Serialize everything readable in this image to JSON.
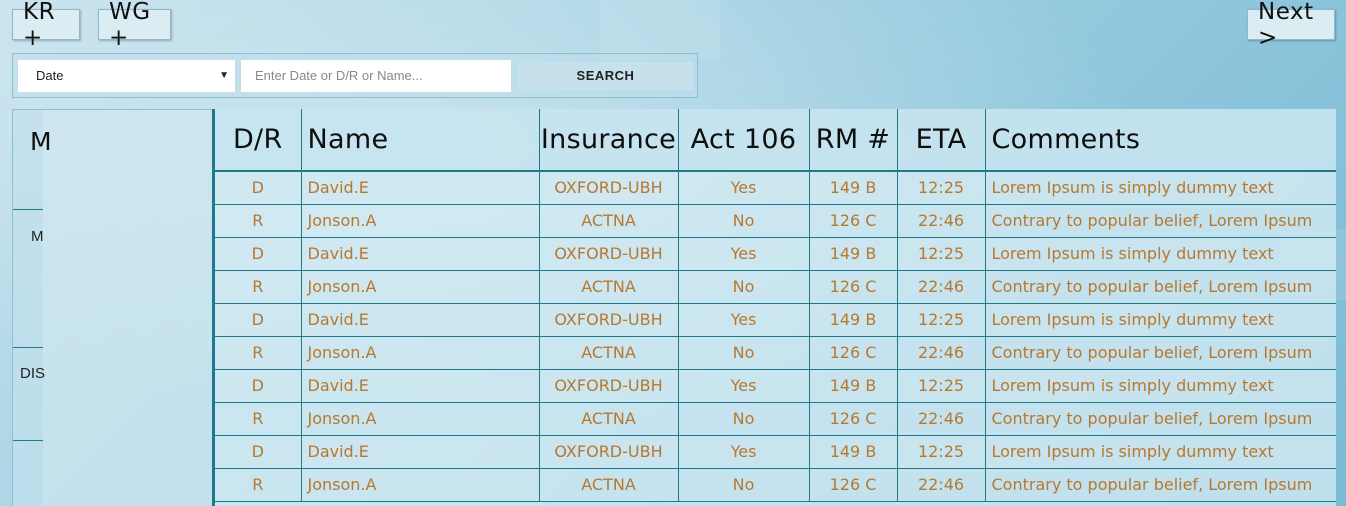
{
  "top_buttons": {
    "kr": "KR +",
    "wg": "WG +",
    "next": "Next >"
  },
  "search": {
    "select_value": "Date",
    "placeholder": "Enter Date or D/R or Name...",
    "button": "SEARCH"
  },
  "left_panel": {
    "heading": "M",
    "items": [
      "M",
      "DIS"
    ]
  },
  "table": {
    "columns": [
      "D/R",
      "Name",
      "Insurance",
      "Act 106",
      "RM #",
      "ETA",
      "Comments"
    ],
    "rows": [
      [
        "D",
        "David.E",
        "OXFORD-UBH",
        "Yes",
        "149 B",
        "12:25",
        "Lorem Ipsum is simply dummy text"
      ],
      [
        "R",
        "Jonson.A",
        "ACTNA",
        "No",
        "126 C",
        "22:46",
        "Contrary to popular belief, Lorem Ipsum"
      ],
      [
        "D",
        "David.E",
        "OXFORD-UBH",
        "Yes",
        "149 B",
        "12:25",
        "Lorem Ipsum is simply dummy text"
      ],
      [
        "R",
        "Jonson.A",
        "ACTNA",
        "No",
        "126 C",
        "22:46",
        "Contrary to popular belief, Lorem Ipsum"
      ],
      [
        "D",
        "David.E",
        "OXFORD-UBH",
        "Yes",
        "149 B",
        "12:25",
        "Lorem Ipsum is simply dummy text"
      ],
      [
        "R",
        "Jonson.A",
        "ACTNA",
        "No",
        "126 C",
        "22:46",
        "Contrary to popular belief, Lorem Ipsum"
      ],
      [
        "D",
        "David.E",
        "OXFORD-UBH",
        "Yes",
        "149 B",
        "12:25",
        "Lorem Ipsum is simply dummy text"
      ],
      [
        "R",
        "Jonson.A",
        "ACTNA",
        "No",
        "126 C",
        "22:46",
        "Contrary to popular belief, Lorem Ipsum"
      ],
      [
        "D",
        "David.E",
        "OXFORD-UBH",
        "Yes",
        "149 B",
        "12:25",
        "Lorem Ipsum is simply dummy text"
      ],
      [
        "R",
        "Jonson.A",
        "ACTNA",
        "No",
        "126 C",
        "22:46",
        "Contrary to popular belief, Lorem Ipsum"
      ]
    ]
  },
  "icons": {
    "select_caret": "caret-down-icon"
  },
  "colors": {
    "cell_text": "#b8782e",
    "grid_line": "#1e7a8a",
    "header_text": "#0e0e0e"
  }
}
